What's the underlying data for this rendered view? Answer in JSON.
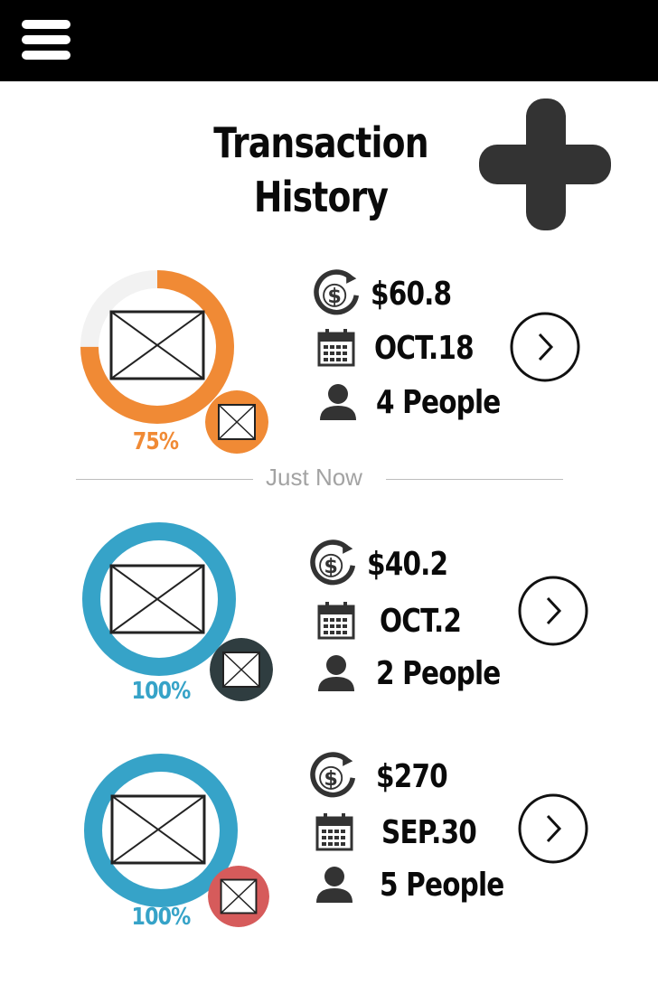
{
  "header": {
    "menu_icon": "hamburger-menu-icon"
  },
  "page": {
    "title_line1": "Transaction",
    "title_line2": "History",
    "add_icon": "plus-icon"
  },
  "divider_label": "Just Now",
  "colors": {
    "orange": "#f08a35",
    "blue": "#36a3c8",
    "dark_teal": "#2f3d40",
    "red": "#d65b5b",
    "icon_dark": "#333333"
  },
  "transactions": [
    {
      "percent_label": "75%",
      "progress": 0.75,
      "ring_color": "#f08a35",
      "badge_color": "#f08a35",
      "amount": "$60.8",
      "date": "OCT.18",
      "people": "4 People"
    },
    {
      "percent_label": "100%",
      "progress": 1.0,
      "ring_color": "#36a3c8",
      "badge_color": "#2f3d40",
      "amount": "$40.2",
      "date": "OCT.2",
      "people": "2 People"
    },
    {
      "percent_label": "100%",
      "progress": 1.0,
      "ring_color": "#36a3c8",
      "badge_color": "#d65b5b",
      "amount": "$270",
      "date": "SEP.30",
      "people": "5 People"
    }
  ]
}
